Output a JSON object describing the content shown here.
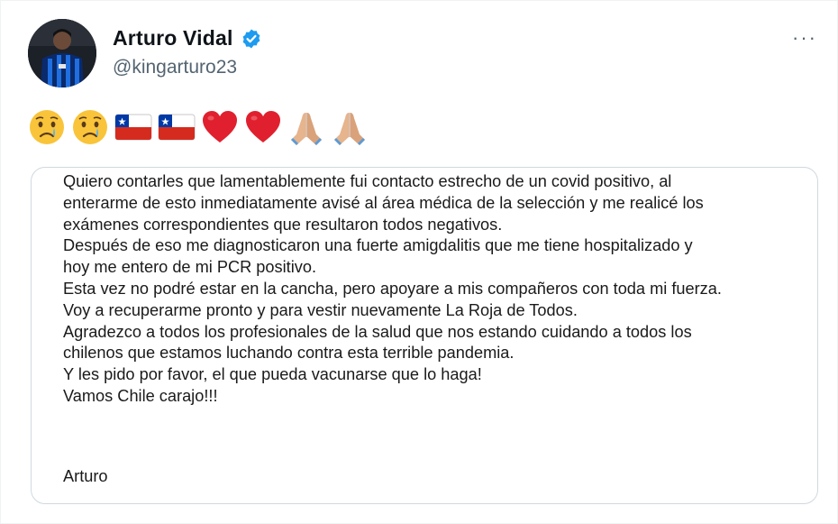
{
  "author": {
    "display_name": "Arturo Vidal",
    "handle": "@kingarturo23",
    "verified": true
  },
  "more_menu": {
    "label": "···"
  },
  "emojis": [
    "crying-face-icon",
    "crying-face-icon",
    "chile-flag-icon",
    "chile-flag-icon",
    "red-heart-icon",
    "red-heart-icon",
    "folded-hands-icon",
    "folded-hands-icon"
  ],
  "statement": {
    "lines": [
      "Quiero contarles que lamentablemente fui contacto estrecho de un covid positivo, al",
      "enterarme de esto inmediatamente avisé al área médica de la selección y me realicé los",
      "exámenes correspondientes que resultaron todos negativos.",
      "Después de eso me diagnosticaron una fuerte amigdalitis que me tiene hospitalizado y",
      "hoy me entero de mi PCR positivo.",
      "Esta vez no podré estar en la cancha, pero apoyare a mis compañeros con toda mi fuerza.",
      "Voy a recuperarme pronto y para vestir nuevamente La Roja de Todos.",
      "Agradezco a todos los profesionales de la salud que nos estando cuidando a todos los",
      "chilenos que estamos luchando contra esta terrible pandemia.",
      "Y les pido por favor, el que pueda vacunarse que lo haga!",
      "Vamos Chile carajo!!!"
    ],
    "signature": "Arturo"
  },
  "colors": {
    "verified_badge": "#1d9bf0",
    "handle_gray": "#536471",
    "card_border": "#cfd9de"
  }
}
